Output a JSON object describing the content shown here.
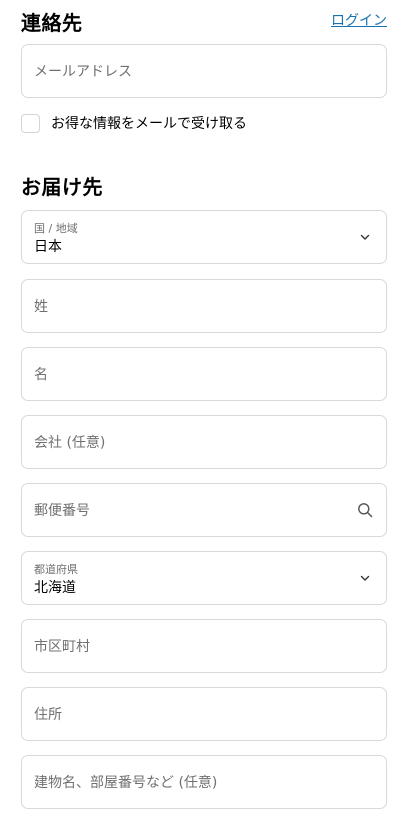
{
  "contact": {
    "title": "連絡先",
    "login_link": "ログイン",
    "email_placeholder": "メールアドレス",
    "newsletter_label": "お得な情報をメールで受け取る",
    "newsletter_checked": false
  },
  "shipping": {
    "title": "お届け先",
    "country": {
      "label": "国 / 地域",
      "value": "日本"
    },
    "last_name_placeholder": "姓",
    "first_name_placeholder": "名",
    "company_placeholder": "会社 (任意)",
    "postal_code_placeholder": "郵便番号",
    "prefecture": {
      "label": "都道府県",
      "value": "北海道"
    },
    "city_placeholder": "市区町村",
    "address_placeholder": "住所",
    "apartment_placeholder": "建物名、部屋番号など (任意)"
  },
  "icons": {
    "dropdown": "chevron-down-icon",
    "search": "search-icon"
  },
  "colors": {
    "link": "#1773b0",
    "border": "#d9d9d9",
    "placeholder": "#707070"
  }
}
